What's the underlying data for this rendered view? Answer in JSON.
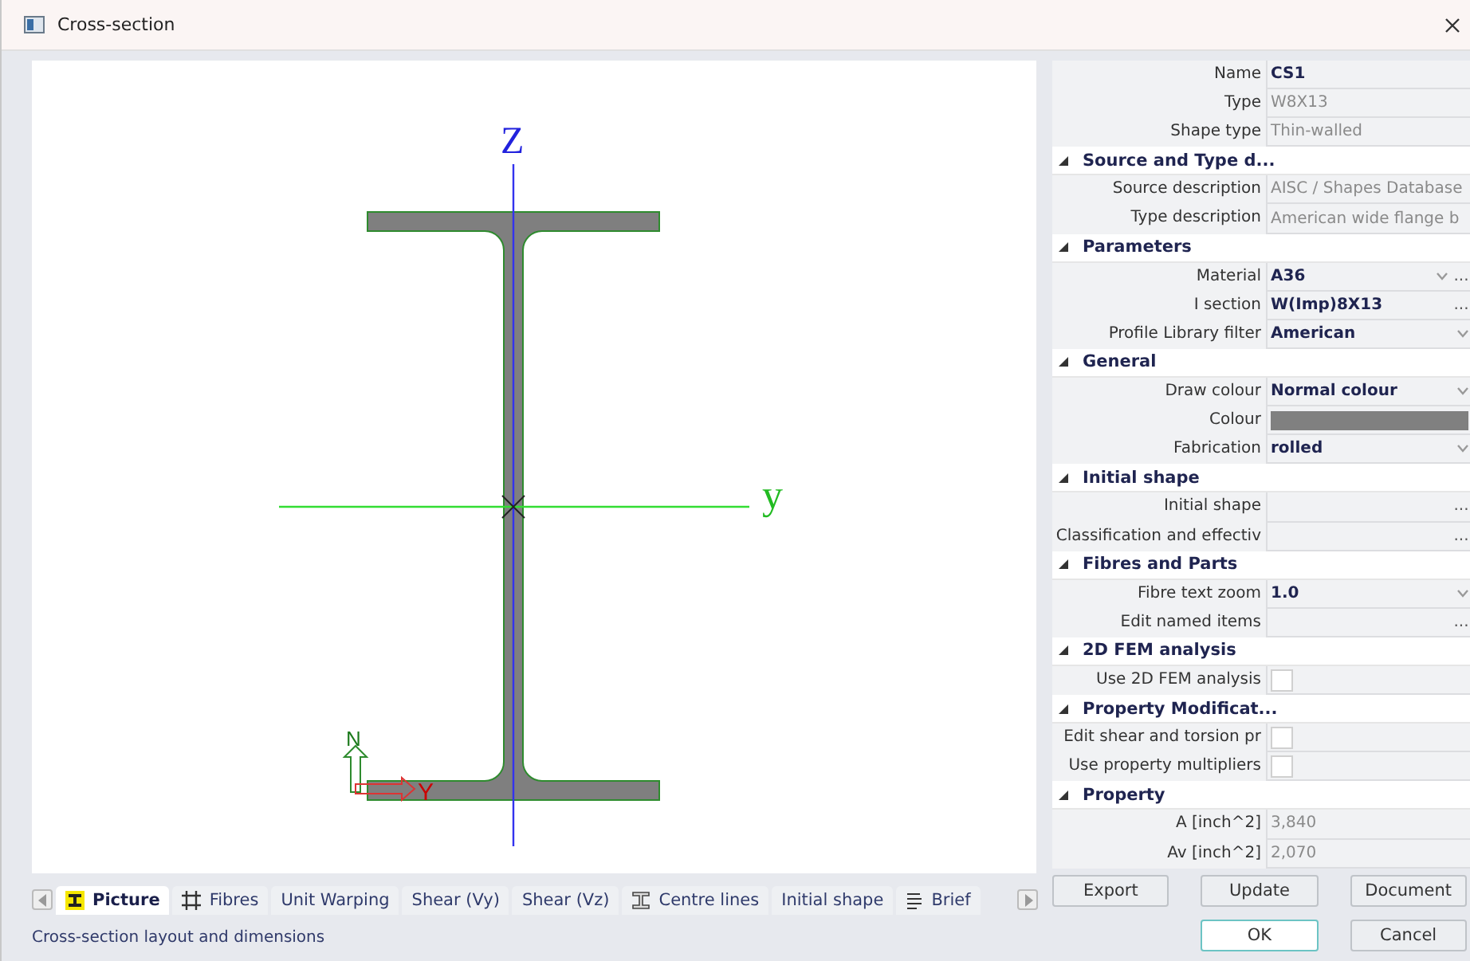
{
  "window": {
    "title": "Cross-section"
  },
  "drawing": {
    "axis_z": "Z",
    "axis_y": "y",
    "local_n": "N",
    "local_y": "Y"
  },
  "tabs": [
    {
      "label": "Picture",
      "kind": "picture",
      "selected": true
    },
    {
      "label": "Fibres",
      "kind": "fibres",
      "selected": false
    },
    {
      "label": "Unit Warping",
      "kind": "plain",
      "selected": false
    },
    {
      "label": "Shear (Vy)",
      "kind": "plain",
      "selected": false
    },
    {
      "label": "Shear (Vz)",
      "kind": "plain",
      "selected": false
    },
    {
      "label": "Centre lines",
      "kind": "outline",
      "selected": false
    },
    {
      "label": "Initial shape",
      "kind": "plain",
      "selected": false
    },
    {
      "label": "Brief",
      "kind": "brief",
      "selected": false
    }
  ],
  "properties": [
    {
      "kind": "row",
      "label": "Name",
      "value": "CS1",
      "disabled": false
    },
    {
      "kind": "row",
      "label": "Type",
      "value": "W8X13",
      "disabled": true
    },
    {
      "kind": "row",
      "label": "Shape type",
      "value": "Thin-walled",
      "disabled": true
    },
    {
      "kind": "section",
      "title": "Source and Type d...",
      "expanded": true
    },
    {
      "kind": "row",
      "label": "Source description",
      "value": "AISC / Shapes Database",
      "disabled": true
    },
    {
      "kind": "row",
      "label": "Type description",
      "value": "American wide flange b",
      "disabled": true
    },
    {
      "kind": "section",
      "title": "Parameters",
      "expanded": true
    },
    {
      "kind": "row",
      "label": "Material",
      "value": "A36",
      "disabled": false,
      "dropdown": true,
      "more": "..."
    },
    {
      "kind": "row",
      "label": "I section",
      "value": "W(Imp)8X13",
      "disabled": false,
      "more": "..."
    },
    {
      "kind": "row",
      "label": "Profile Library filter",
      "value": "American",
      "disabled": false,
      "dropdown": true
    },
    {
      "kind": "section",
      "title": "General",
      "expanded": true
    },
    {
      "kind": "row",
      "label": "Draw colour",
      "value": "Normal colour",
      "disabled": false,
      "dropdown": true
    },
    {
      "kind": "color",
      "label": "Colour",
      "color": "#808080"
    },
    {
      "kind": "row",
      "label": "Fabrication",
      "value": "rolled",
      "disabled": false,
      "dropdown": true
    },
    {
      "kind": "section",
      "title": "Initial shape",
      "expanded": true
    },
    {
      "kind": "row",
      "label": "Initial shape",
      "more": "..."
    },
    {
      "kind": "row",
      "label": "Classification and effectiv",
      "more": "..."
    },
    {
      "kind": "section",
      "title": "Fibres and Parts",
      "expanded": true
    },
    {
      "kind": "row",
      "label": "Fibre text zoom",
      "value": "1.0",
      "disabled": false,
      "dropdown": true
    },
    {
      "kind": "row",
      "label": "Edit named items",
      "more": "..."
    },
    {
      "kind": "section",
      "title": "2D FEM analysis",
      "expanded": true
    },
    {
      "kind": "checkbox",
      "label": "Use 2D FEM analysis",
      "checked": false
    },
    {
      "kind": "section",
      "title": "Property Modificat...",
      "expanded": true
    },
    {
      "kind": "checkbox",
      "label": "Edit shear and torsion pr",
      "checked": false
    },
    {
      "kind": "checkbox",
      "label": "Use property multipliers",
      "checked": false
    },
    {
      "kind": "section",
      "title": "Property",
      "expanded": true
    },
    {
      "kind": "row",
      "label": "A [inch^2]",
      "value": "3,840",
      "disabled": true
    },
    {
      "kind": "row",
      "label": "Av [inch^2]",
      "value": "2,070",
      "disabled": true
    }
  ],
  "buttons": [
    {
      "label": "Export",
      "default": false
    },
    {
      "label": "Update",
      "default": false
    },
    {
      "label": "Document",
      "default": false
    },
    {
      "label": "OK",
      "default": true
    },
    {
      "label": "Cancel",
      "default": false
    }
  ],
  "status_bar": "Cross-section layout and dimensions"
}
